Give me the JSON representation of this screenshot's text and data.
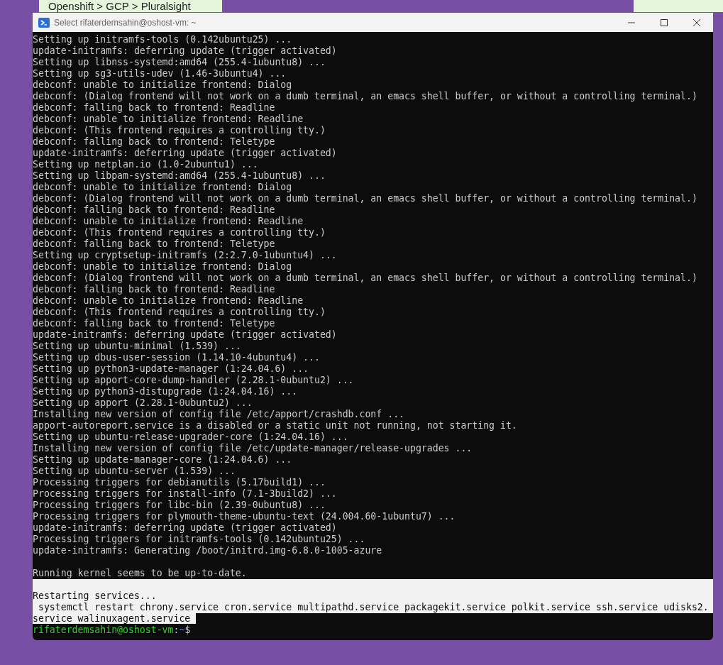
{
  "browser_tabs": [
    {
      "label": "Openshift > GCP > Pluralsight"
    }
  ],
  "window": {
    "title": "Select rifaterdemsahin@oshost-vm: ~"
  },
  "terminal": {
    "lines": [
      {
        "text": "Setting up initramfs-tools (0.142ubuntu25) ...",
        "selected": false
      },
      {
        "text": "update-initramfs: deferring update (trigger activated)",
        "selected": false
      },
      {
        "text": "Setting up libnss-systemd:amd64 (255.4-1ubuntu8) ...",
        "selected": false
      },
      {
        "text": "Setting up sg3-utils-udev (1.46-3ubuntu4) ...",
        "selected": false
      },
      {
        "text": "debconf: unable to initialize frontend: Dialog",
        "selected": false
      },
      {
        "text": "debconf: (Dialog frontend will not work on a dumb terminal, an emacs shell buffer, or without a controlling terminal.)",
        "selected": false
      },
      {
        "text": "debconf: falling back to frontend: Readline",
        "selected": false
      },
      {
        "text": "debconf: unable to initialize frontend: Readline",
        "selected": false
      },
      {
        "text": "debconf: (This frontend requires a controlling tty.)",
        "selected": false
      },
      {
        "text": "debconf: falling back to frontend: Teletype",
        "selected": false
      },
      {
        "text": "update-initramfs: deferring update (trigger activated)",
        "selected": false
      },
      {
        "text": "Setting up netplan.io (1.0-2ubuntu1) ...",
        "selected": false
      },
      {
        "text": "Setting up libpam-systemd:amd64 (255.4-1ubuntu8) ...",
        "selected": false
      },
      {
        "text": "debconf: unable to initialize frontend: Dialog",
        "selected": false
      },
      {
        "text": "debconf: (Dialog frontend will not work on a dumb terminal, an emacs shell buffer, or without a controlling terminal.)",
        "selected": false
      },
      {
        "text": "debconf: falling back to frontend: Readline",
        "selected": false
      },
      {
        "text": "debconf: unable to initialize frontend: Readline",
        "selected": false
      },
      {
        "text": "debconf: (This frontend requires a controlling tty.)",
        "selected": false
      },
      {
        "text": "debconf: falling back to frontend: Teletype",
        "selected": false
      },
      {
        "text": "Setting up cryptsetup-initramfs (2:2.7.0-1ubuntu4) ...",
        "selected": false
      },
      {
        "text": "debconf: unable to initialize frontend: Dialog",
        "selected": false
      },
      {
        "text": "debconf: (Dialog frontend will not work on a dumb terminal, an emacs shell buffer, or without a controlling terminal.)",
        "selected": false
      },
      {
        "text": "debconf: falling back to frontend: Readline",
        "selected": false
      },
      {
        "text": "debconf: unable to initialize frontend: Readline",
        "selected": false
      },
      {
        "text": "debconf: (This frontend requires a controlling tty.)",
        "selected": false
      },
      {
        "text": "debconf: falling back to frontend: Teletype",
        "selected": false
      },
      {
        "text": "update-initramfs: deferring update (trigger activated)",
        "selected": false
      },
      {
        "text": "Setting up ubuntu-minimal (1.539) ...",
        "selected": false
      },
      {
        "text": "Setting up dbus-user-session (1.14.10-4ubuntu4) ...",
        "selected": false
      },
      {
        "text": "Setting up python3-update-manager (1:24.04.6) ...",
        "selected": false
      },
      {
        "text": "Setting up apport-core-dump-handler (2.28.1-0ubuntu2) ...",
        "selected": false
      },
      {
        "text": "Setting up python3-distupgrade (1:24.04.16) ...",
        "selected": false
      },
      {
        "text": "Setting up apport (2.28.1-0ubuntu2) ...",
        "selected": false
      },
      {
        "text": "Installing new version of config file /etc/apport/crashdb.conf ...",
        "selected": false
      },
      {
        "text": "apport-autoreport.service is a disabled or a static unit not running, not starting it.",
        "selected": false
      },
      {
        "text": "Setting up ubuntu-release-upgrader-core (1:24.04.16) ...",
        "selected": false
      },
      {
        "text": "Installing new version of config file /etc/update-manager/release-upgrades ...",
        "selected": false
      },
      {
        "text": "Setting up update-manager-core (1:24.04.6) ...",
        "selected": false
      },
      {
        "text": "Setting up ubuntu-server (1.539) ...",
        "selected": false
      },
      {
        "text": "Processing triggers for debianutils (5.17build1) ...",
        "selected": false
      },
      {
        "text": "Processing triggers for install-info (7.1-3build2) ...",
        "selected": false
      },
      {
        "text": "Processing triggers for libc-bin (2.39-0ubuntu8) ...",
        "selected": false
      },
      {
        "text": "Processing triggers for plymouth-theme-ubuntu-text (24.004.60-1ubuntu7) ...",
        "selected": false
      },
      {
        "text": "update-initramfs: deferring update (trigger activated)",
        "selected": false
      },
      {
        "text": "Processing triggers for initramfs-tools (0.142ubuntu25) ...",
        "selected": false
      },
      {
        "text": "update-initramfs: Generating /boot/initrd.img-6.8.0-1005-azure",
        "selected": false
      },
      {
        "text": "Running kernel seems to be up-to-date.",
        "selected": false,
        "blank_line_before": true
      },
      {
        "selected": true
      },
      {
        "text": "Restarting services...",
        "selected": true
      },
      {
        "text": " systemctl restart chrony.service cron.service multipathd.service packagekit.service polkit.service ssh.service udisks2.",
        "selected": true
      },
      {
        "text": "service walinuxagent.service ",
        "selected": true
      }
    ],
    "prompt": {
      "user_host": "rifaterdemsahin@oshost-vm",
      "separator": ":",
      "path": "~",
      "symbol": "$"
    }
  }
}
